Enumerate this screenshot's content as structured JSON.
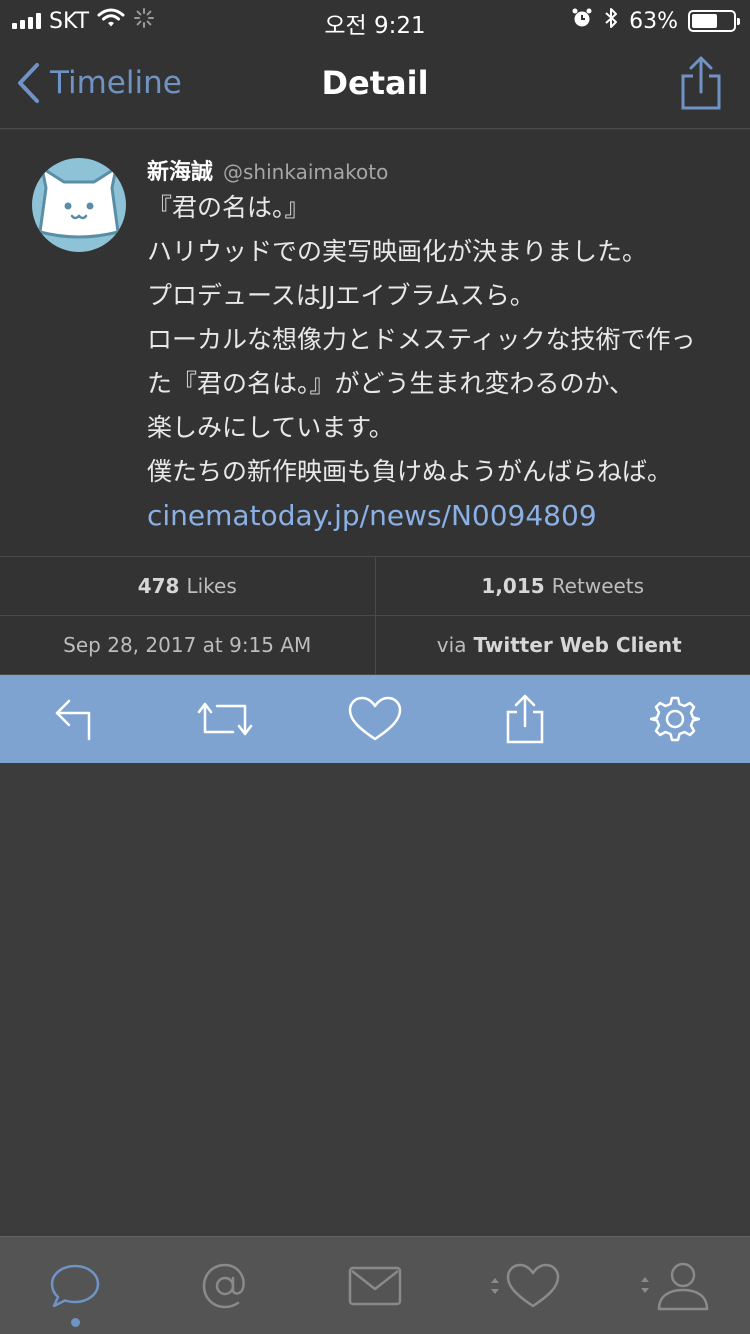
{
  "status_bar": {
    "carrier": "SKT",
    "time": "오전 9:21",
    "battery_percent": "63%",
    "battery_level": 0.63,
    "icons": [
      "signal-icon",
      "wifi-icon",
      "activity-icon",
      "alarm-icon",
      "bluetooth-icon",
      "battery-icon"
    ]
  },
  "nav": {
    "back_label": "Timeline",
    "title": "Detail"
  },
  "tweet": {
    "author_name": "新海誠",
    "author_handle": "@shinkaimakoto",
    "lines": [
      "『君の名は。』",
      "ハリウッドでの実写映画化が決まりました。",
      "プロデュースはJJエイブラムスら。",
      "ローカルな想像力とドメスティックな技術で作っ",
      "た『君の名は。』がどう生まれ変わるのか、",
      "楽しみにしています。",
      "僕たちの新作映画も負けぬようがんばらねば。"
    ],
    "link": "cinematoday.jp/news/N0094809"
  },
  "stats": {
    "likes_count": "478",
    "likes_label": "Likes",
    "retweets_count": "1,015",
    "retweets_label": "Retweets",
    "timestamp": "Sep 28, 2017 at 9:15 AM",
    "via_prefix": "via",
    "via_client": "Twitter Web Client"
  },
  "actions": [
    "reply-icon",
    "retweet-icon",
    "like-icon",
    "share-icon",
    "settings-icon"
  ],
  "tabs": [
    "timeline-tab",
    "mentions-tab",
    "messages-tab",
    "favorites-tab",
    "profile-tab"
  ],
  "colors": {
    "accent": "#6f93c4",
    "link": "#8ab0e6",
    "action_bar": "#7ea3d0",
    "background": "#3c3c3c",
    "surface": "#333333",
    "tab_bar": "#545454"
  }
}
